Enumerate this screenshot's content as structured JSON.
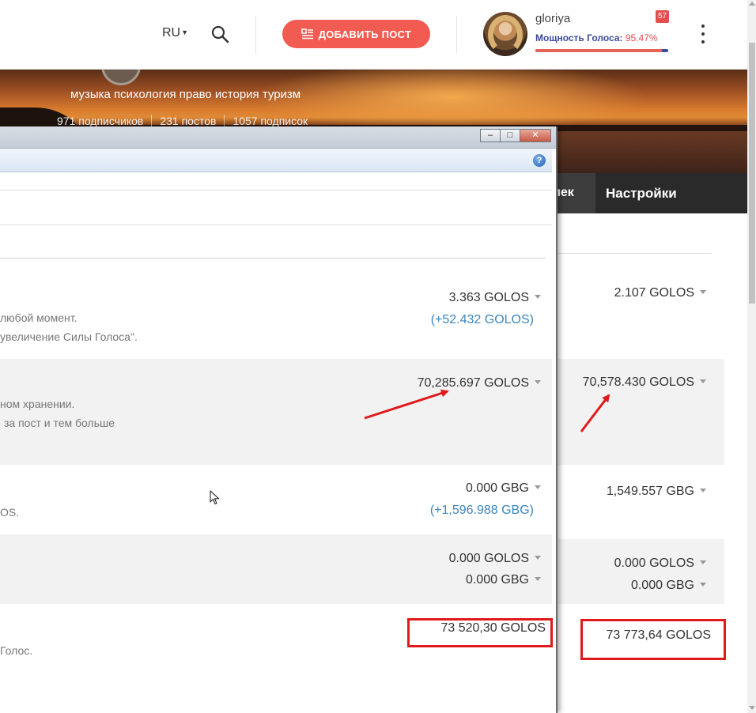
{
  "header": {
    "lang": "RU",
    "add_post_label": "ДОБАВИТЬ ПОСТ",
    "username": "gloriya",
    "notif_count": "57",
    "power_label": "Мощность Голоса:",
    "power_value": "95.47%",
    "power_fraction": 0.9547
  },
  "profile": {
    "interests": "музыка психология право история туризм",
    "followers": "971 подписчиков",
    "posts": "231 постов",
    "following": "1057 подписок"
  },
  "tabs": {
    "wallet": "елек",
    "settings": "Настройки"
  },
  "page_wallet": {
    "golos": "2.107 GOLOS",
    "golos_power": "70,578.430 GOLOS",
    "gbg": "1,549.557 GBG",
    "savings_golos": "0.000 GOLOS",
    "savings_gbg": "0.000 GBG",
    "total": "73 773,64 GOLOS"
  },
  "window": {
    "buttons": {
      "min": "–",
      "max": "□",
      "close": "✕"
    },
    "help": "?",
    "golos_desc_1": "любой момент.",
    "golos_desc_2": "увеличение Силы Голоса\".",
    "golos": "3.363 GOLOS",
    "golos_delta": "(+52.432 GOLOS)",
    "power_desc_1": "ном хранении.",
    "power_desc_2": "за пост и тем больше",
    "golos_power": "70,285.697 GOLOS",
    "gbg_desc": "OS.",
    "gbg": "0.000 GBG",
    "gbg_delta": "(+1,596.988 GBG)",
    "savings_golos": "0.000 GOLOS",
    "savings_gbg": "0.000 GBG",
    "total_desc": "Голос.",
    "total": "73 520,30 GOLOS"
  },
  "icons": {
    "search": "search-icon",
    "add_post": "post-list-icon",
    "kebab": "kebab-menu-icon",
    "help": "help-icon",
    "cursor": "mouse-cursor-icon"
  },
  "colors": {
    "accent": "#f25b51",
    "power_blue": "#3b4aa0",
    "link_blue": "#3a86bd",
    "annotation_red": "#e01a1a"
  }
}
